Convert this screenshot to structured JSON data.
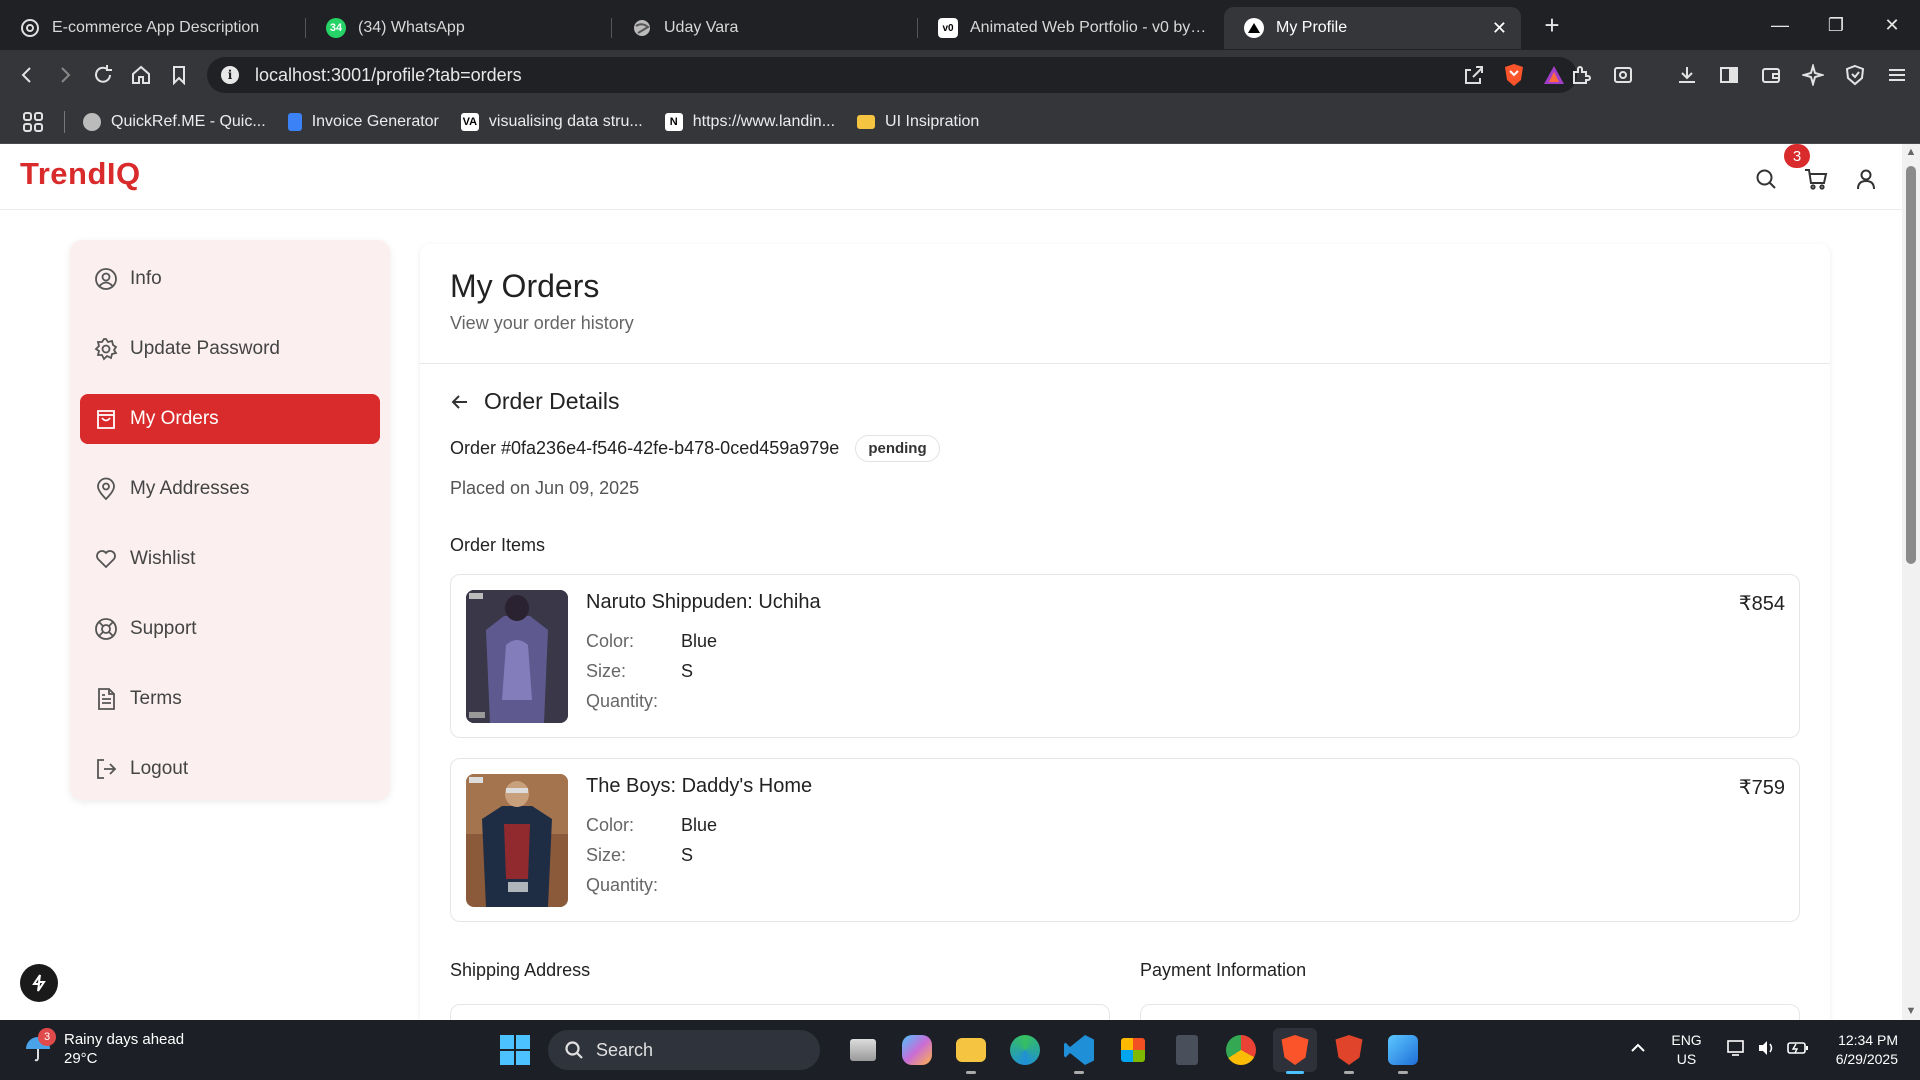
{
  "browser": {
    "tabs": [
      {
        "title": "E-commerce App Description",
        "icon": "openai-icon"
      },
      {
        "title": "(34) WhatsApp",
        "icon": "whatsapp-icon",
        "badge": "34"
      },
      {
        "title": "Uday Vara",
        "icon": "globe-icon"
      },
      {
        "title": "Animated Web Portfolio - v0 by Vercel",
        "icon": "v0-icon"
      },
      {
        "title": "My Profile",
        "icon": "vercel-icon",
        "active": true
      }
    ],
    "url": "localhost:3001/profile?tab=orders",
    "bookmarks": [
      {
        "label": "QuickRef.ME - Quic..."
      },
      {
        "label": "Invoice Generator"
      },
      {
        "label": "visualising data stru..."
      },
      {
        "label": "https://www.landin..."
      },
      {
        "label": "UI Insipration"
      }
    ]
  },
  "site": {
    "logo": "TrendIQ",
    "cart_count": "3",
    "brand_color": "#d92b2b"
  },
  "sidebar": {
    "items": [
      {
        "label": "Info",
        "icon": "user-circle-icon"
      },
      {
        "label": "Update Password",
        "icon": "gear-icon"
      },
      {
        "label": "My Orders",
        "icon": "shopping-bag-icon",
        "active": true
      },
      {
        "label": "My Addresses",
        "icon": "map-pin-icon"
      },
      {
        "label": "Wishlist",
        "icon": "heart-icon"
      },
      {
        "label": "Support",
        "icon": "lifebuoy-icon"
      },
      {
        "label": "Terms",
        "icon": "document-icon"
      },
      {
        "label": "Logout",
        "icon": "logout-icon"
      }
    ]
  },
  "main": {
    "title": "My Orders",
    "subtitle": "View your order history",
    "order_details_label": "Order Details",
    "order_id": "Order #0fa236e4-f546-42fe-b478-0ced459a979e",
    "status": "pending",
    "placed": "Placed on Jun 09, 2025",
    "items_label": "Order Items",
    "attr_labels": {
      "color": "Color:",
      "size": "Size:",
      "quantity": "Quantity:"
    },
    "items": [
      {
        "name": "Naruto Shippuden: Uchiha",
        "price": "₹854",
        "color": "Blue",
        "size": "S",
        "quantity": ""
      },
      {
        "name": "The Boys: Daddy's Home",
        "price": "₹759",
        "color": "Blue",
        "size": "S",
        "quantity": ""
      }
    ],
    "shipping_label": "Shipping Address",
    "payment_label": "Payment Information"
  },
  "taskbar": {
    "weather_title": "Rainy days ahead",
    "weather_temp": "29°C",
    "weather_badge": "3",
    "search_label": "Search",
    "lang_top": "ENG",
    "lang_bottom": "US",
    "time": "12:34 PM",
    "date": "6/29/2025"
  }
}
